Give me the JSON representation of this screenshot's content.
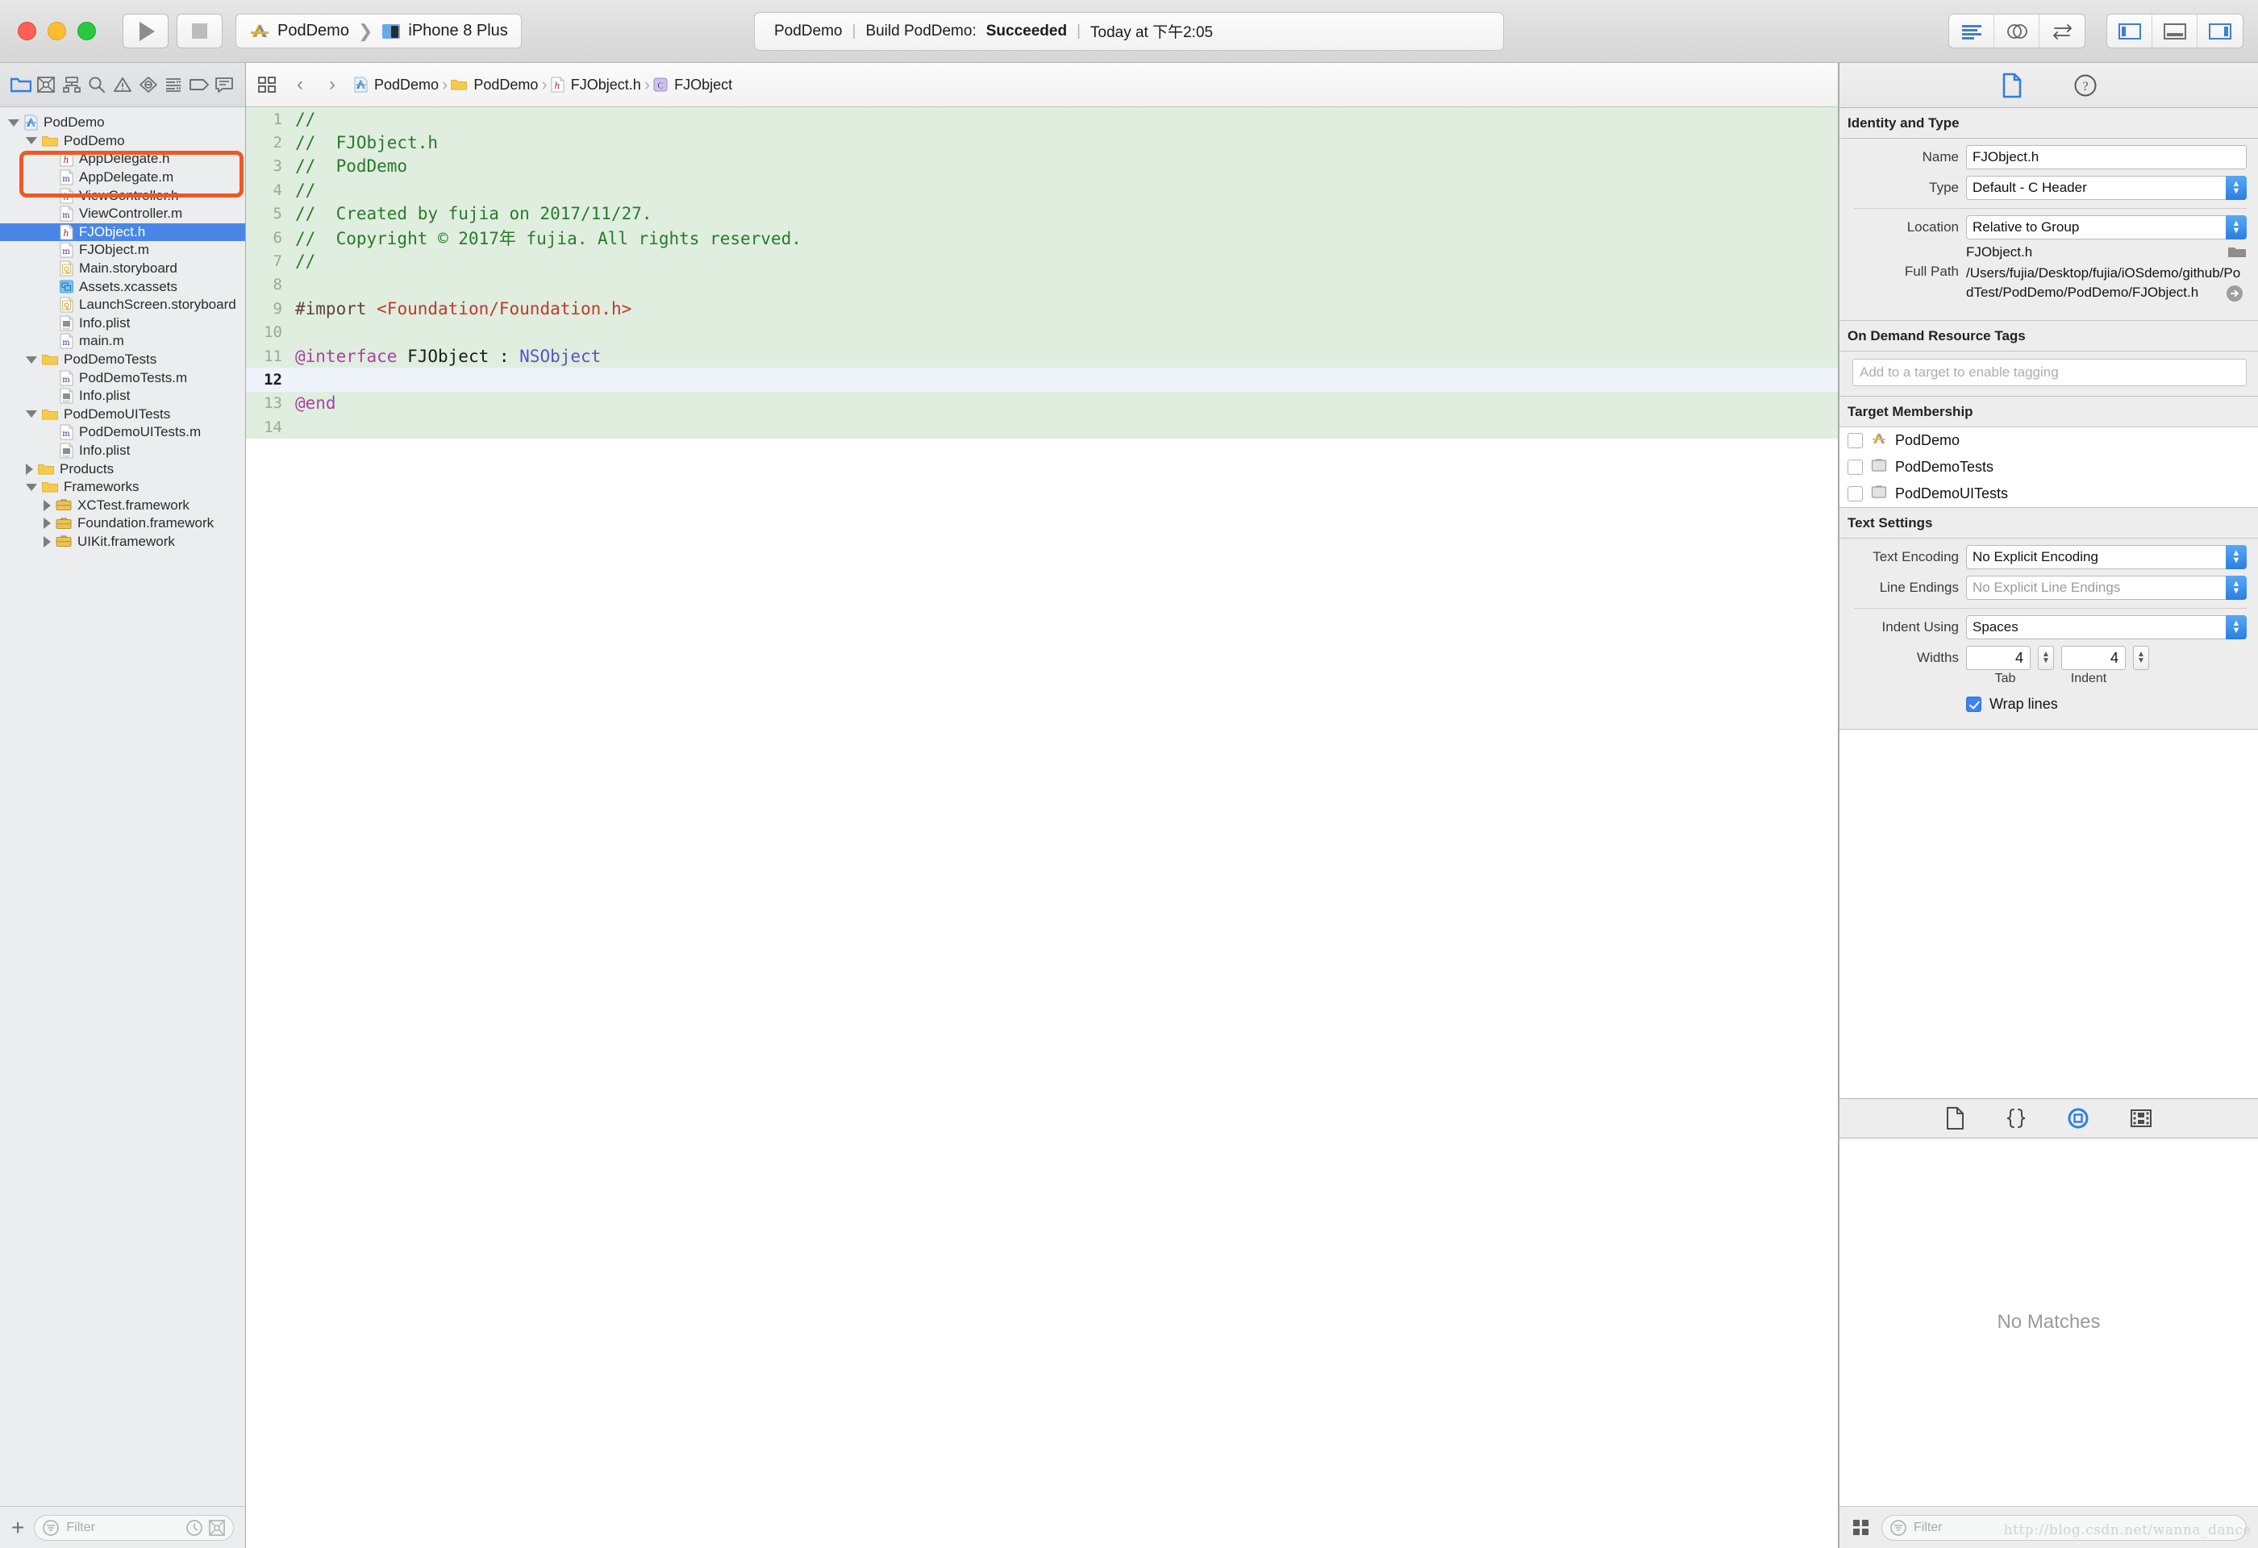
{
  "window": {
    "traffic_lights": [
      "close",
      "minimize",
      "zoom"
    ]
  },
  "toolbar": {
    "run_button": "run-button",
    "stop_button": "stop-button",
    "scheme": "PodDemo",
    "scheme_separator": "❯",
    "destination": "iPhone 8 Plus",
    "status": {
      "project": "PodDemo",
      "sep": "|",
      "action_prefix": "Build PodDemo: ",
      "action_result": "Succeeded",
      "time": "Today at 下午2:05"
    },
    "editor_buttons": [
      "standard-editor-icon",
      "assistant-editor-icon",
      "version-editor-icon"
    ],
    "view_buttons": [
      "navigator-toggle-icon",
      "debug-area-toggle-icon",
      "inspector-toggle-icon"
    ]
  },
  "navigator": {
    "tabs": [
      "folder-icon",
      "source-control-icon",
      "symbol-icon",
      "search-icon",
      "issue-icon",
      "test-icon",
      "debug-icon",
      "breakpoint-icon",
      "report-icon"
    ],
    "tree": [
      {
        "label": "PodDemo",
        "depth": 0,
        "icon": "xcode-project-icon",
        "disc": "down"
      },
      {
        "label": "PodDemo",
        "depth": 1,
        "icon": "folder-icon",
        "disc": "down"
      },
      {
        "label": "AppDelegate.h",
        "depth": 2,
        "icon": "h-file-icon",
        "disc": "none"
      },
      {
        "label": "AppDelegate.m",
        "depth": 2,
        "icon": "m-file-icon",
        "disc": "none"
      },
      {
        "label": "ViewController.h",
        "depth": 2,
        "icon": "h-file-icon",
        "disc": "none"
      },
      {
        "label": "ViewController.m",
        "depth": 2,
        "icon": "m-file-icon",
        "disc": "none"
      },
      {
        "label": "FJObject.h",
        "depth": 2,
        "icon": "h-file-icon",
        "disc": "none",
        "selected": true
      },
      {
        "label": "FJObject.m",
        "depth": 2,
        "icon": "m-file-icon",
        "disc": "none"
      },
      {
        "label": "Main.storyboard",
        "depth": 2,
        "icon": "storyboard-icon",
        "disc": "none"
      },
      {
        "label": "Assets.xcassets",
        "depth": 2,
        "icon": "assets-icon",
        "disc": "none"
      },
      {
        "label": "LaunchScreen.storyboard",
        "depth": 2,
        "icon": "storyboard-icon",
        "disc": "none"
      },
      {
        "label": "Info.plist",
        "depth": 2,
        "icon": "plist-icon",
        "disc": "none"
      },
      {
        "label": "main.m",
        "depth": 2,
        "icon": "m-file-icon",
        "disc": "none"
      },
      {
        "label": "PodDemoTests",
        "depth": 1,
        "icon": "folder-icon",
        "disc": "down"
      },
      {
        "label": "PodDemoTests.m",
        "depth": 2,
        "icon": "m-file-icon",
        "disc": "none"
      },
      {
        "label": "Info.plist",
        "depth": 2,
        "icon": "plist-icon",
        "disc": "none"
      },
      {
        "label": "PodDemoUITests",
        "depth": 1,
        "icon": "folder-icon",
        "disc": "down"
      },
      {
        "label": "PodDemoUITests.m",
        "depth": 2,
        "icon": "m-file-icon",
        "disc": "none"
      },
      {
        "label": "Info.plist",
        "depth": 2,
        "icon": "plist-icon",
        "disc": "none"
      },
      {
        "label": "Products",
        "depth": 1,
        "icon": "folder-icon",
        "disc": "right"
      },
      {
        "label": "Frameworks",
        "depth": 1,
        "icon": "folder-icon",
        "disc": "down"
      },
      {
        "label": "XCTest.framework",
        "depth": 2,
        "icon": "framework-icon",
        "disc": "right"
      },
      {
        "label": "Foundation.framework",
        "depth": 2,
        "icon": "framework-icon",
        "disc": "right"
      },
      {
        "label": "UIKit.framework",
        "depth": 2,
        "icon": "framework-icon",
        "disc": "right"
      }
    ],
    "add_button": "+",
    "filter_placeholder": "Filter"
  },
  "editor": {
    "jumpbar": {
      "related_items": "related-items-icon",
      "back": "‹",
      "forward": "›",
      "crumbs": [
        {
          "label": "PodDemo",
          "icon": "xcode-project-icon"
        },
        {
          "label": "PodDemo",
          "icon": "folder-icon"
        },
        {
          "label": "FJObject.h",
          "icon": "h-file-icon"
        },
        {
          "label": "FJObject",
          "icon": "class-icon"
        }
      ]
    },
    "current_line": 12,
    "total_rendered_lines": 14,
    "lines": [
      {
        "n": 1,
        "tokens": [
          {
            "t": "//",
            "c": "cmt"
          }
        ]
      },
      {
        "n": 2,
        "tokens": [
          {
            "t": "//  FJObject.h",
            "c": "cmt"
          }
        ]
      },
      {
        "n": 3,
        "tokens": [
          {
            "t": "//  PodDemo",
            "c": "cmt"
          }
        ]
      },
      {
        "n": 4,
        "tokens": [
          {
            "t": "//",
            "c": "cmt"
          }
        ]
      },
      {
        "n": 5,
        "tokens": [
          {
            "t": "//  Created by fujia on 2017/11/27.",
            "c": "cmt"
          }
        ]
      },
      {
        "n": 6,
        "tokens": [
          {
            "t": "//  Copyright © 2017年 fujia. All rights reserved.",
            "c": "cmt"
          }
        ]
      },
      {
        "n": 7,
        "tokens": [
          {
            "t": "//",
            "c": "cmt"
          }
        ]
      },
      {
        "n": 8,
        "tokens": []
      },
      {
        "n": 9,
        "tokens": [
          {
            "t": "#import ",
            "c": "pre"
          },
          {
            "t": "<Foundation/Foundation.h>",
            "c": "str"
          }
        ]
      },
      {
        "n": 10,
        "tokens": []
      },
      {
        "n": 11,
        "tokens": [
          {
            "t": "@interface",
            "c": "kw"
          },
          {
            "t": " FJObject : ",
            "c": "pln"
          },
          {
            "t": "NSObject",
            "c": "typ"
          }
        ]
      },
      {
        "n": 12,
        "tokens": []
      },
      {
        "n": 13,
        "tokens": [
          {
            "t": "@end",
            "c": "kw"
          }
        ]
      },
      {
        "n": 14,
        "tokens": []
      }
    ]
  },
  "inspector": {
    "tabs": [
      "file-inspector-icon",
      "quick-help-icon"
    ],
    "identity_and_type": {
      "title": "Identity and Type",
      "name_label": "Name",
      "name_value": "FJObject.h",
      "type_label": "Type",
      "type_value": "Default - C Header",
      "location_label": "Location",
      "location_value": "Relative to Group",
      "relative_path": "FJObject.h",
      "full_path_label": "Full Path",
      "full_path_value": "/Users/fujia/Desktop/fujia/iOSdemo/github/PodTest/PodDemo/PodDemo/FJObject.h"
    },
    "on_demand": {
      "title": "On Demand Resource Tags",
      "placeholder": "Add to a target to enable tagging"
    },
    "target_membership": {
      "title": "Target Membership",
      "items": [
        {
          "label": "PodDemo",
          "checked": false,
          "icon": "app-target-icon"
        },
        {
          "label": "PodDemoTests",
          "checked": false,
          "icon": "test-target-icon"
        },
        {
          "label": "PodDemoUITests",
          "checked": false,
          "icon": "test-target-icon"
        }
      ]
    },
    "text_settings": {
      "title": "Text Settings",
      "encoding_label": "Text Encoding",
      "encoding_value": "No Explicit Encoding",
      "line_endings_label": "Line Endings",
      "line_endings_value": "No Explicit Line Endings",
      "indent_label": "Indent Using",
      "indent_value": "Spaces",
      "widths_label": "Widths",
      "tab_width": "4",
      "indent_width": "4",
      "tab_sublabel": "Tab",
      "indent_sublabel": "Indent",
      "wrap_lines_label": "Wrap lines",
      "wrap_lines_checked": true
    },
    "library": {
      "tabs": [
        "file-template-library-icon",
        "code-snippet-library-icon",
        "object-library-icon",
        "media-library-icon"
      ],
      "empty_message": "No Matches",
      "layout_button": "grid-layout-icon",
      "filter_placeholder": "Filter"
    }
  },
  "watermark": "http://blog.csdn.net/wanna_dance",
  "colors": {
    "selection_blue": "#4a86e8",
    "annotation_orange": "#ec5a24",
    "code_background": "#dfeedf",
    "current_line": "#eef3fc",
    "accent_blue": "#3b82f6"
  }
}
